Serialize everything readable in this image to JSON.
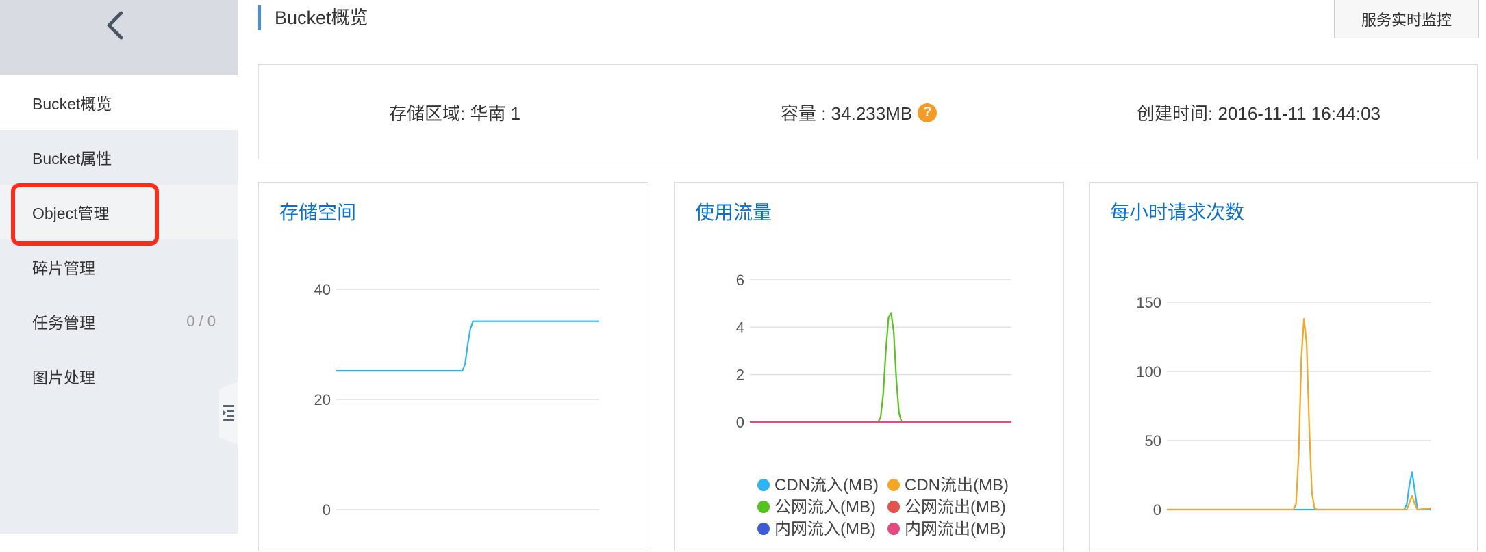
{
  "sidebar": {
    "back_icon": "chevron-left-icon",
    "items": [
      {
        "label": "Bucket概览",
        "count": ""
      },
      {
        "label": "Bucket属性",
        "count": ""
      },
      {
        "label": "Object管理",
        "count": ""
      },
      {
        "label": "碎片管理",
        "count": ""
      },
      {
        "label": "任务管理",
        "count": "0 / 0"
      },
      {
        "label": "图片处理",
        "count": ""
      }
    ],
    "active_index": 0,
    "highlight_color": "#ff2a17"
  },
  "header": {
    "title": "Bucket概览",
    "monitor_button": "服务实时监控",
    "accent": "#3f8ff0"
  },
  "info": {
    "region": "存储区域:  华南 1",
    "capacity": "容量 :  34.233MB",
    "created": "创建时间:  2016-11-11 16:44:03"
  },
  "chart_data": [
    {
      "type": "line",
      "title": "存储空间",
      "yticks": [
        0,
        20,
        40
      ],
      "ylim": [
        0,
        40
      ],
      "series": [
        {
          "color": "#29b6f6",
          "x": [
            0,
            0.48,
            0.49,
            0.5,
            0.51,
            0.52,
            0.55,
            1
          ],
          "values": [
            25.2,
            25.2,
            26.5,
            30.0,
            32.8,
            34.2,
            34.2,
            34.2
          ]
        }
      ],
      "grid": true
    },
    {
      "type": "line",
      "title": "使用流量",
      "yticks": [
        0,
        2,
        4,
        6
      ],
      "ylim": [
        0,
        6
      ],
      "series": [
        {
          "name": "CDN流入(MB)",
          "color": "#29b6f6",
          "x": [
            0,
            1
          ],
          "values": [
            0,
            0
          ]
        },
        {
          "name": "CDN流出(MB)",
          "color": "#f5a623",
          "x": [
            0,
            1
          ],
          "values": [
            0,
            0
          ]
        },
        {
          "name": "公网流入(MB)",
          "color": "#52c41a",
          "x": [
            0,
            0.49,
            0.5,
            0.51,
            0.52,
            0.53,
            0.54,
            0.55,
            0.56,
            0.57,
            0.58,
            1
          ],
          "values": [
            0,
            0,
            0.2,
            1.2,
            3.0,
            4.4,
            4.6,
            3.8,
            1.8,
            0.4,
            0,
            0
          ]
        },
        {
          "name": "公网流出(MB)",
          "color": "#e5534b",
          "x": [
            0,
            1
          ],
          "values": [
            0,
            0
          ]
        },
        {
          "name": "内网流入(MB)",
          "color": "#3b5bdb",
          "x": [
            0,
            1
          ],
          "values": [
            0,
            0
          ]
        },
        {
          "name": "内网流出(MB)",
          "color": "#e64980",
          "x": [
            0,
            1
          ],
          "values": [
            0,
            0
          ]
        }
      ],
      "legend_position": "bottom",
      "grid": true
    },
    {
      "type": "line",
      "title": "每小时请求次数",
      "yticks": [
        0,
        50,
        100,
        150
      ],
      "ylim": [
        0,
        150
      ],
      "series": [
        {
          "color": "#29b6f6",
          "x": [
            0,
            0.9,
            0.91,
            0.92,
            0.93,
            0.94,
            0.95,
            1
          ],
          "values": [
            0,
            0,
            4,
            18,
            27,
            14,
            0,
            0
          ]
        },
        {
          "color": "#f5a623",
          "x": [
            0,
            0.48,
            0.49,
            0.5,
            0.51,
            0.52,
            0.53,
            0.54,
            0.55,
            0.56,
            0.57,
            0.91,
            0.92,
            0.93,
            0.94,
            0.95,
            1
          ],
          "values": [
            0,
            0,
            4,
            40,
            110,
            138,
            120,
            60,
            12,
            1,
            0,
            0,
            5,
            10,
            4,
            0,
            1
          ]
        }
      ],
      "grid": true
    }
  ]
}
